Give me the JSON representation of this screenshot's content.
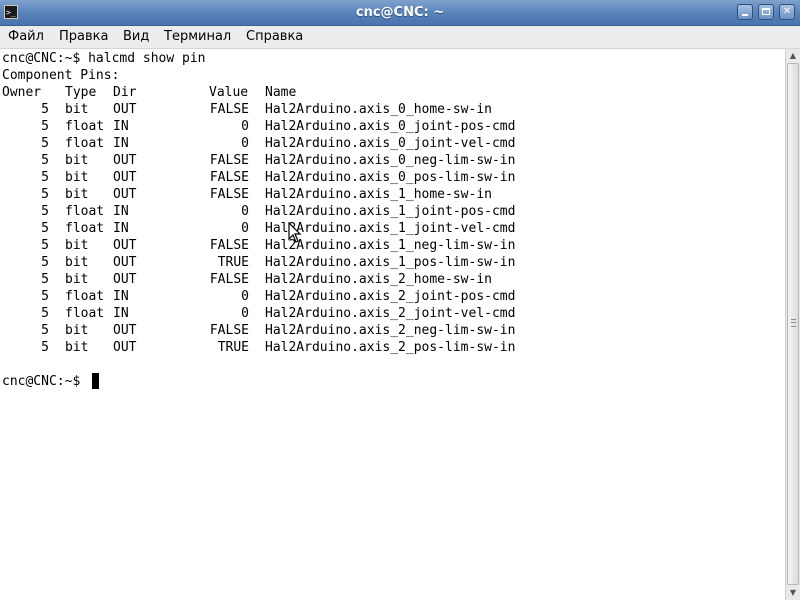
{
  "window": {
    "title": "cnc@CNC: ~"
  },
  "menubar": {
    "items": [
      {
        "label": "Файл"
      },
      {
        "label": "Правка"
      },
      {
        "label": "Вид"
      },
      {
        "label": "Терминал"
      },
      {
        "label": "Справка"
      }
    ]
  },
  "terminal": {
    "command_line": "cnc@CNC:~$ halcmd show pin",
    "section_title": "Component Pins:",
    "headers": {
      "owner": "Owner",
      "type": "Type",
      "dir": "Dir",
      "value": "Value",
      "name": "Name"
    },
    "rows": [
      {
        "owner": "5",
        "type": "bit",
        "dir": "OUT",
        "value": "FALSE",
        "name": "Hal2Arduino.axis_0_home-sw-in"
      },
      {
        "owner": "5",
        "type": "float",
        "dir": "IN",
        "value": "0",
        "name": "Hal2Arduino.axis_0_joint-pos-cmd"
      },
      {
        "owner": "5",
        "type": "float",
        "dir": "IN",
        "value": "0",
        "name": "Hal2Arduino.axis_0_joint-vel-cmd"
      },
      {
        "owner": "5",
        "type": "bit",
        "dir": "OUT",
        "value": "FALSE",
        "name": "Hal2Arduino.axis_0_neg-lim-sw-in"
      },
      {
        "owner": "5",
        "type": "bit",
        "dir": "OUT",
        "value": "FALSE",
        "name": "Hal2Arduino.axis_0_pos-lim-sw-in"
      },
      {
        "owner": "5",
        "type": "bit",
        "dir": "OUT",
        "value": "FALSE",
        "name": "Hal2Arduino.axis_1_home-sw-in"
      },
      {
        "owner": "5",
        "type": "float",
        "dir": "IN",
        "value": "0",
        "name": "Hal2Arduino.axis_1_joint-pos-cmd"
      },
      {
        "owner": "5",
        "type": "float",
        "dir": "IN",
        "value": "0",
        "name": "Hal2Arduino.axis_1_joint-vel-cmd"
      },
      {
        "owner": "5",
        "type": "bit",
        "dir": "OUT",
        "value": "FALSE",
        "name": "Hal2Arduino.axis_1_neg-lim-sw-in"
      },
      {
        "owner": "5",
        "type": "bit",
        "dir": "OUT",
        "value": "TRUE",
        "name": "Hal2Arduino.axis_1_pos-lim-sw-in"
      },
      {
        "owner": "5",
        "type": "bit",
        "dir": "OUT",
        "value": "FALSE",
        "name": "Hal2Arduino.axis_2_home-sw-in"
      },
      {
        "owner": "5",
        "type": "float",
        "dir": "IN",
        "value": "0",
        "name": "Hal2Arduino.axis_2_joint-pos-cmd"
      },
      {
        "owner": "5",
        "type": "float",
        "dir": "IN",
        "value": "0",
        "name": "Hal2Arduino.axis_2_joint-vel-cmd"
      },
      {
        "owner": "5",
        "type": "bit",
        "dir": "OUT",
        "value": "FALSE",
        "name": "Hal2Arduino.axis_2_neg-lim-sw-in"
      },
      {
        "owner": "5",
        "type": "bit",
        "dir": "OUT",
        "value": "TRUE",
        "name": "Hal2Arduino.axis_2_pos-lim-sw-in"
      }
    ],
    "prompt": "cnc@CNC:~$"
  },
  "icons": {
    "app": "terminal-icon",
    "minimize": "minimize-icon",
    "maximize": "maximize-icon",
    "close": "close-icon",
    "pointer": "mouse-pointer-icon"
  },
  "colors": {
    "titlebar": "#5a83bb",
    "terminal_bg": "#ffffff",
    "terminal_fg": "#000000",
    "menubar_bg": "#ededed"
  }
}
